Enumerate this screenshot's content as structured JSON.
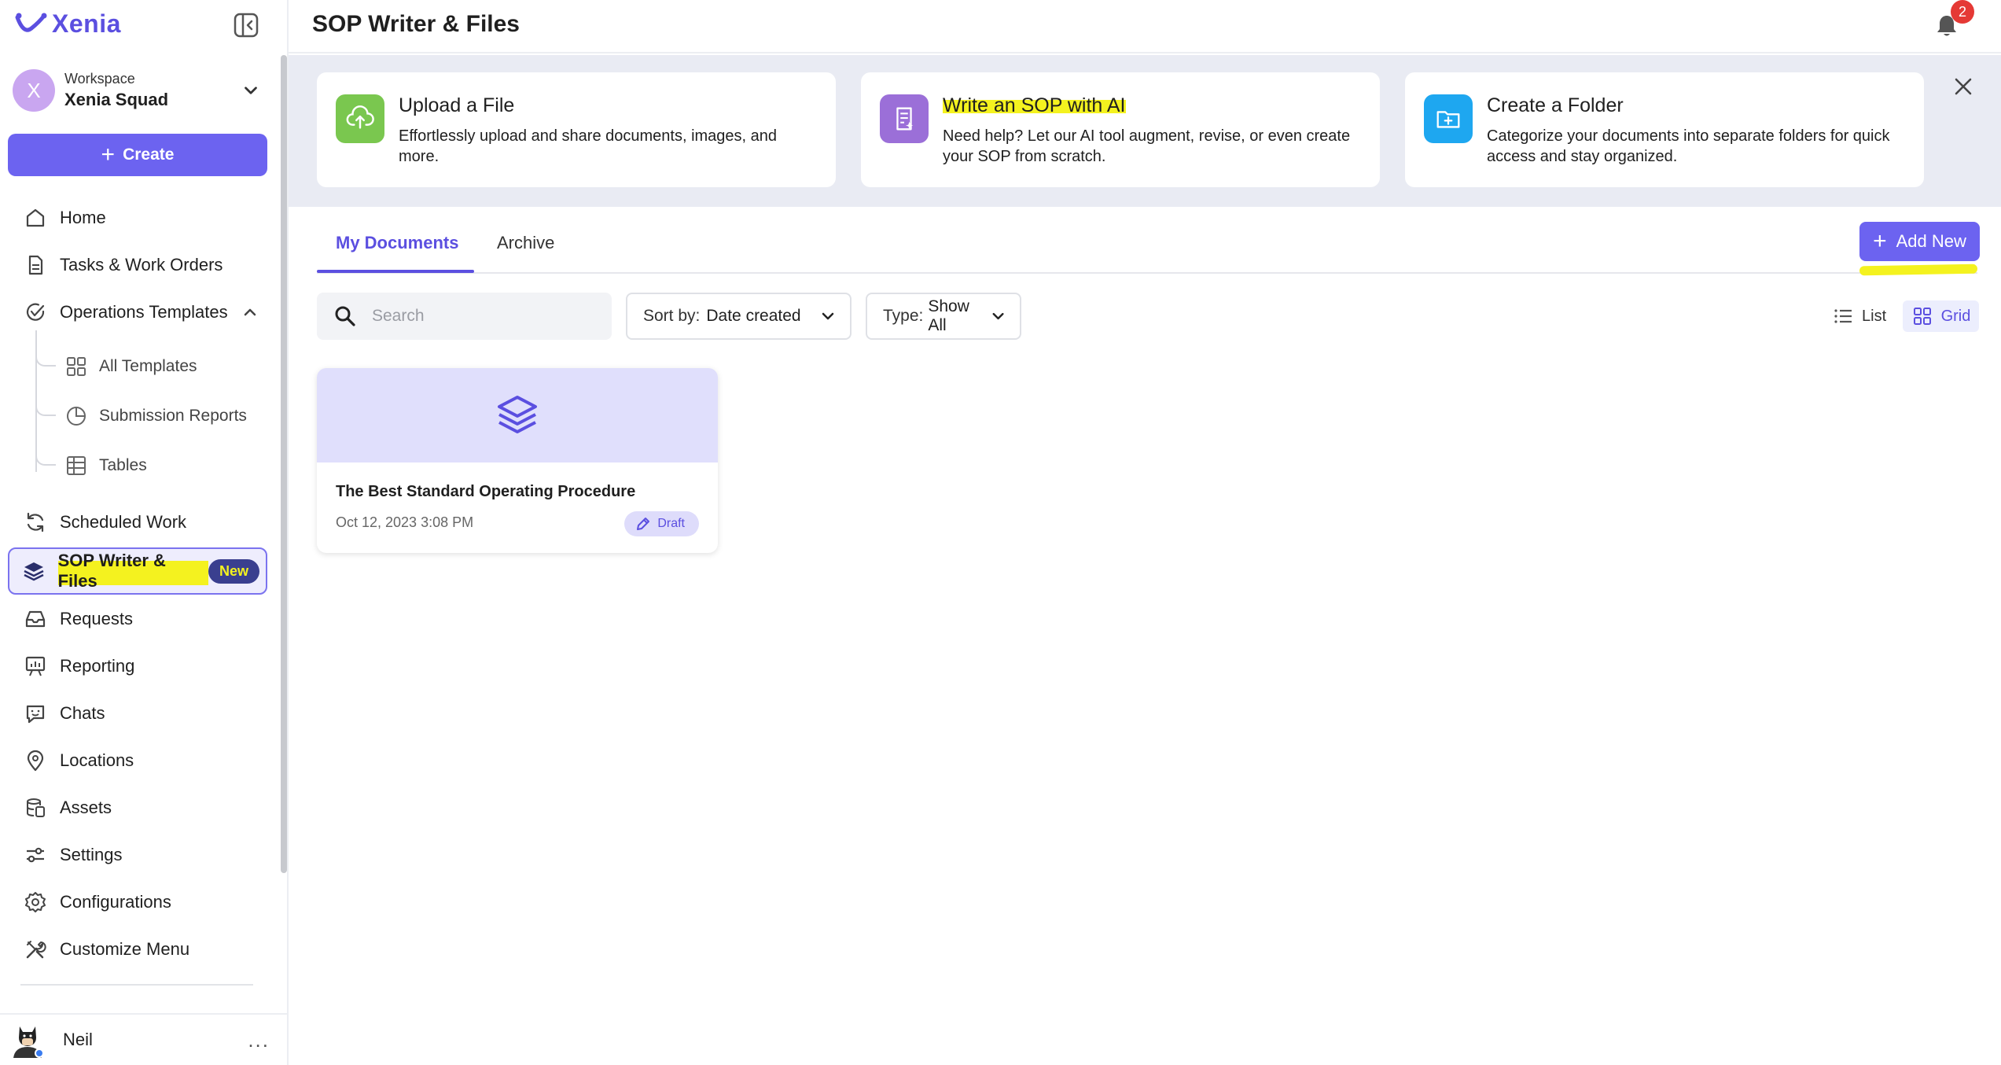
{
  "app": {
    "name": "Xenia"
  },
  "sidebar": {
    "workspace": {
      "avatar_letter": "X",
      "label": "Workspace",
      "name": "Xenia Squad"
    },
    "create_label": "Create",
    "items": {
      "home": "Home",
      "tasks": "Tasks & Work Orders",
      "operations_templates": "Operations Templates",
      "all_templates": "All Templates",
      "submission_reports": "Submission Reports",
      "tables": "Tables",
      "scheduled_work": "Scheduled Work",
      "sop_writer": "SOP Writer & Files",
      "sop_badge": "New",
      "requests": "Requests",
      "reporting": "Reporting",
      "chats": "Chats",
      "locations": "Locations",
      "assets": "Assets",
      "settings": "Settings",
      "configurations": "Configurations",
      "customize_menu": "Customize Menu"
    },
    "user": {
      "name": "Neil",
      "more": "..."
    }
  },
  "header": {
    "title": "SOP Writer & Files",
    "notification_count": "2"
  },
  "banner": {
    "cards": [
      {
        "title": "Upload a File",
        "desc": "Effortlessly upload and share documents, images, and more.",
        "icon": "upload-cloud-icon",
        "color": "#7ac74f"
      },
      {
        "title": "Write an SOP with AI",
        "desc": "Need help? Let our AI tool augment, revise, or even create your SOP from scratch.",
        "icon": "ai-document-icon",
        "color": "#9b6fd8"
      },
      {
        "title": "Create a Folder",
        "desc": "Categorize your documents into separate folders for quick access and stay organized.",
        "icon": "folder-plus-icon",
        "color": "#1ea7f0"
      }
    ]
  },
  "tabs": {
    "my_documents": "My Documents",
    "archive": "Archive"
  },
  "actions": {
    "add_new": "Add New"
  },
  "filters": {
    "search_placeholder": "Search",
    "sort_label": "Sort by:",
    "sort_value": "Date created",
    "type_label": "Type:",
    "type_value": "Show All"
  },
  "view": {
    "list": "List",
    "grid": "Grid"
  },
  "documents": [
    {
      "title": "The Best Standard Operating Procedure",
      "date": "Oct 12, 2023 3:08 PM",
      "status": "Draft"
    }
  ],
  "colors": {
    "accent": "#6c63f0",
    "highlight": "#f4f21f",
    "badge_red": "#e53935"
  }
}
